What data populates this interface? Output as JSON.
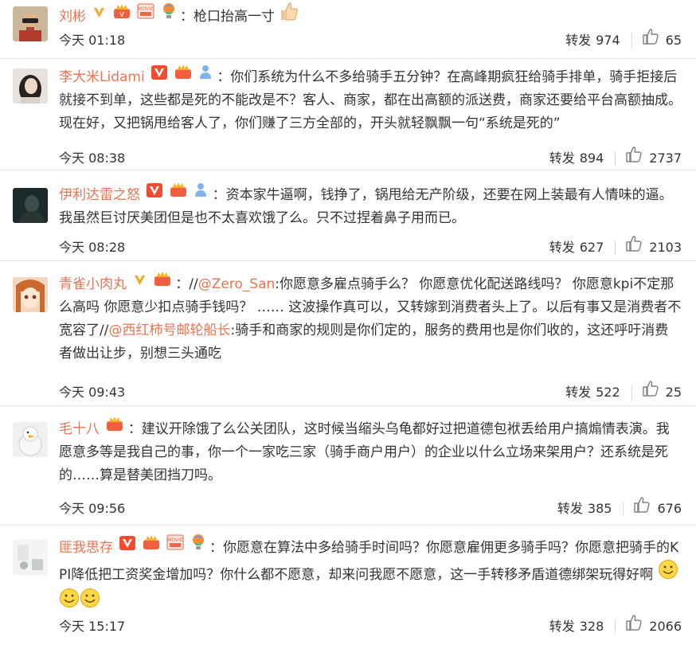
{
  "colors": {
    "username": "#eb7350",
    "text": "#333333",
    "meta": "#808080",
    "divider": "#e8e8e8"
  },
  "ui": {
    "forward_label": "转发"
  },
  "comments": [
    {
      "user": "刘彬",
      "badges": [
        "verified-v-icon",
        "crown-icon",
        "movie-badge-icon",
        "lightbulb-icon"
      ],
      "text": "：枪口抬高一寸",
      "time": "今天 01:18",
      "forward": "974",
      "likes": "65"
    },
    {
      "user": "李大米Lidami",
      "badges": [
        "verified-v-icon",
        "crown-icon",
        "person-badge-icon"
      ],
      "text": "：你们系统为什么不多给骑手五分钟？在高峰期疯狂给骑手排单，骑手拒接后就接不到单，这些都是死的不能改是不？客人、商家，都在出高额的派送费，商家还要给平台高额抽成。现在好，又把锅甩给客人了，你们赚了三方全部的，开头就轻飘飘一句“系统是死的”",
      "time": "今天 08:38",
      "forward": "894",
      "likes": "2737"
    },
    {
      "user": "伊利达雷之怒",
      "badges": [
        "verified-v-icon",
        "crown-icon",
        "person-badge-icon"
      ],
      "text": "：资本家牛逼啊，钱挣了，锅甩给无产阶级，还要在网上装最有人情味的逼。我虽然巨讨厌美团但是也不太喜欢饿了么。只不过捏着鼻子用而已。",
      "time": "今天 08:28",
      "forward": "627",
      "likes": "2103"
    },
    {
      "user": "青雀小肉丸",
      "badges": [
        "verified-v-icon",
        "crown-icon"
      ],
      "text_a": "：//",
      "mention_a": "@Zero_San",
      "text_b": ":你愿意多雇点骑手么？ 你愿意优化配送路线吗？ 你愿意kpi不定那么高吗 你愿意少扣点骑手钱吗？ …… 这波操作真可以，又转嫁到消费者头上了。以后有事又是消费者不宽容了//",
      "mention_b": "@西红柿号邮轮船长",
      "text_c": ":骑手和商家的规则是你们定的，服务的费用也是你们收的，这还呼吁消费者做出让步，别想三头通吃",
      "time": "今天 09:43",
      "forward": "522",
      "likes": "25"
    },
    {
      "user": "毛十八",
      "badges": [
        "crown-icon"
      ],
      "text": "：建议开除饿了么公关团队，这时候当缩头乌龟都好过把道德包袱丢给用户搞煽情表演。我愿意多等是我自己的事，你一个一家吃三家（骑手商户用户）的企业以什么立场来架用户？还系统是死的……算是替美团挡刀吗。",
      "time": "今天 09:56",
      "forward": "385",
      "likes": "676"
    },
    {
      "user": "匪我思存",
      "badges": [
        "verified-v-icon",
        "crown-icon",
        "movie-badge-icon",
        "lightbulb-icon"
      ],
      "text": "：你愿意在算法中多给骑手时间吗？你愿意雇佣更多骑手吗？你愿意把骑手的KPI降低把工资奖金增加吗？你什么都不愿意，却来问我愿不愿意，这一手转移矛盾道德绑架玩得好啊",
      "time": "今天 15:17",
      "forward": "328",
      "likes": "2066"
    }
  ]
}
